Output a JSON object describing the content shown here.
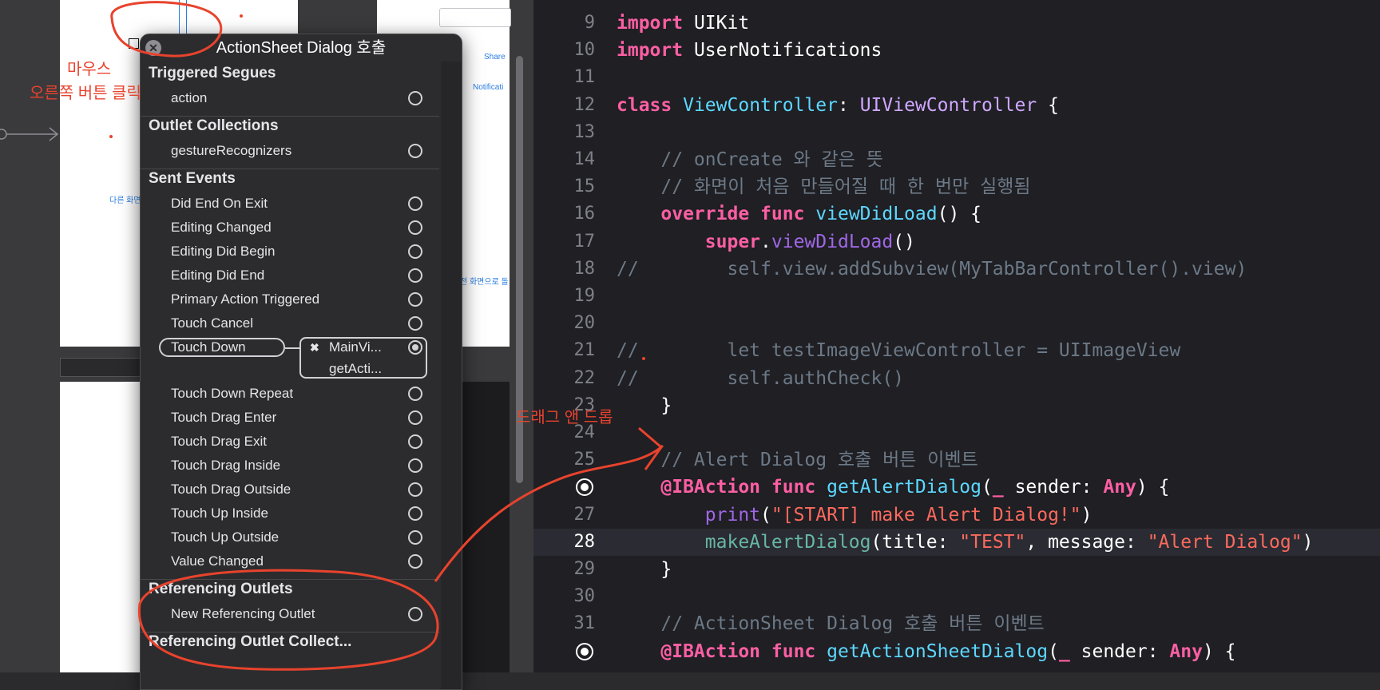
{
  "storyboard": {
    "small_labels": [
      "Share",
      "Notificati",
      "다른 화면",
      "전 화면으로 돌"
    ]
  },
  "hud": {
    "title": "ActionSheet Dialog 호출",
    "sections": [
      {
        "heading": "Triggered Segues",
        "rows": [
          {
            "label": "action"
          }
        ]
      },
      {
        "heading": "Outlet Collections",
        "rows": [
          {
            "label": "gestureRecognizers"
          }
        ]
      },
      {
        "heading": "Sent Events",
        "rows": [
          {
            "label": "Did End On Exit"
          },
          {
            "label": "Editing Changed"
          },
          {
            "label": "Editing Did Begin"
          },
          {
            "label": "Editing Did End"
          },
          {
            "label": "Primary Action Triggered"
          },
          {
            "label": "Touch Cancel"
          },
          {
            "label": "Touch Down",
            "connected": true
          },
          {
            "label": "Touch Down Repeat"
          },
          {
            "label": "Touch Drag Enter"
          },
          {
            "label": "Touch Drag Exit"
          },
          {
            "label": "Touch Drag Inside"
          },
          {
            "label": "Touch Drag Outside"
          },
          {
            "label": "Touch Up Inside"
          },
          {
            "label": "Touch Up Outside"
          },
          {
            "label": "Value Changed"
          }
        ]
      },
      {
        "heading": "Referencing Outlets",
        "rows": [
          {
            "label": "New Referencing Outlet"
          }
        ]
      },
      {
        "heading": "Referencing Outlet Collect...",
        "rows": []
      }
    ],
    "connection": {
      "target": "MainVi...",
      "action": "getActi..."
    }
  },
  "annotations": {
    "mouse_line1": "마우스",
    "mouse_line2": "오른쪽 버튼 클릭",
    "drag": "드래그 앤 드롭"
  },
  "editor": {
    "current_line": 28,
    "lines": [
      {
        "n": 9,
        "tokens": [
          [
            "kw",
            "import"
          ],
          [
            "pl",
            " UIKit"
          ]
        ]
      },
      {
        "n": 10,
        "tokens": [
          [
            "kw",
            "import"
          ],
          [
            "pl",
            " UserNotifications"
          ]
        ]
      },
      {
        "n": 11,
        "tokens": []
      },
      {
        "n": 12,
        "tokens": [
          [
            "kw",
            "class"
          ],
          [
            "pl",
            " "
          ],
          [
            "tyd",
            "ViewController"
          ],
          [
            "pl",
            ": "
          ],
          [
            "ty",
            "UIViewController"
          ],
          [
            "pl",
            " {"
          ]
        ]
      },
      {
        "n": 13,
        "tokens": []
      },
      {
        "n": 14,
        "tokens": [
          [
            "cm",
            "    // onCreate 와 같은 뜻"
          ]
        ]
      },
      {
        "n": 15,
        "tokens": [
          [
            "cm",
            "    // 화면이 처음 만들어질 때 한 번만 실행됨"
          ]
        ]
      },
      {
        "n": 16,
        "tokens": [
          [
            "pl",
            "    "
          ],
          [
            "kw",
            "override"
          ],
          [
            "pl",
            " "
          ],
          [
            "kw",
            "func"
          ],
          [
            "pl",
            " "
          ],
          [
            "tyd",
            "viewDidLoad"
          ],
          [
            "pl",
            "() {"
          ]
        ]
      },
      {
        "n": 17,
        "tokens": [
          [
            "pl",
            "        "
          ],
          [
            "kw",
            "super"
          ],
          [
            "pl",
            "."
          ],
          [
            "fnc",
            "viewDidLoad"
          ],
          [
            "pl",
            "()"
          ]
        ]
      },
      {
        "n": 18,
        "tokens": [
          [
            "cm",
            "//        self.view.addSubview(MyTabBarController().view)"
          ]
        ]
      },
      {
        "n": 19,
        "tokens": []
      },
      {
        "n": 20,
        "tokens": []
      },
      {
        "n": 21,
        "tokens": [
          [
            "cm",
            "//        let testImageViewController = UIImageView"
          ]
        ]
      },
      {
        "n": 22,
        "tokens": [
          [
            "cm",
            "//        self.authCheck()"
          ]
        ]
      },
      {
        "n": 23,
        "tokens": [
          [
            "pl",
            "    }"
          ]
        ]
      },
      {
        "n": 24,
        "tokens": []
      },
      {
        "n": 25,
        "tokens": [
          [
            "cm",
            "    // Alert Dialog 호출 버튼 이벤트"
          ]
        ]
      },
      {
        "n": 26,
        "bp": true,
        "tokens": [
          [
            "pl",
            "    "
          ],
          [
            "kw",
            "@IBAction"
          ],
          [
            "pl",
            " "
          ],
          [
            "kw",
            "func"
          ],
          [
            "pl",
            " "
          ],
          [
            "tyd",
            "getAlertDialog"
          ],
          [
            "pl",
            "("
          ],
          [
            "kw",
            "_"
          ],
          [
            "pl",
            " sender: "
          ],
          [
            "kw",
            "Any"
          ],
          [
            "pl",
            ") {"
          ]
        ]
      },
      {
        "n": 27,
        "tokens": [
          [
            "pl",
            "        "
          ],
          [
            "fnc",
            "print"
          ],
          [
            "pl",
            "("
          ],
          [
            "st",
            "\"[START] make Alert Dialog!\""
          ],
          [
            "pl",
            ")"
          ]
        ]
      },
      {
        "n": 28,
        "tokens": [
          [
            "pl",
            "        "
          ],
          [
            "fn",
            "makeAlertDialog"
          ],
          [
            "pl",
            "(title: "
          ],
          [
            "st",
            "\"TEST\""
          ],
          [
            "pl",
            ", message: "
          ],
          [
            "st",
            "\"Alert Dialog\""
          ],
          [
            "pl",
            ")"
          ]
        ]
      },
      {
        "n": 29,
        "tokens": [
          [
            "pl",
            "    }"
          ]
        ]
      },
      {
        "n": 30,
        "tokens": []
      },
      {
        "n": 31,
        "tokens": [
          [
            "cm",
            "    // ActionSheet Dialog 호출 버튼 이벤트"
          ]
        ]
      },
      {
        "n": 32,
        "bp": true,
        "tokens": [
          [
            "pl",
            "    "
          ],
          [
            "kw",
            "@IBAction"
          ],
          [
            "pl",
            " "
          ],
          [
            "kw",
            "func"
          ],
          [
            "pl",
            " "
          ],
          [
            "tyd",
            "getActionSheetDialog"
          ],
          [
            "pl",
            "("
          ],
          [
            "kw",
            "_"
          ],
          [
            "pl",
            " sender: "
          ],
          [
            "kw",
            "Any"
          ],
          [
            "pl",
            ") {"
          ]
        ]
      }
    ]
  }
}
